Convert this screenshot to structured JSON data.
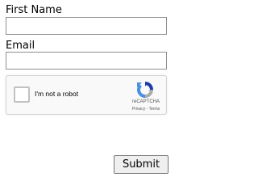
{
  "form": {
    "first_name_label": "First Name",
    "first_name_value": "",
    "email_label": "Email",
    "email_value": "",
    "submit_label": "Submit"
  },
  "recaptcha": {
    "checkbox_label": "I'm not a robot",
    "checked": false,
    "brand": "reCAPTCHA",
    "privacy_link": "Privacy",
    "separator": " - ",
    "terms_link": "Terms",
    "logo_icon": "recaptcha-logo-icon",
    "colors": {
      "blue": "#1c3aa9",
      "light_blue": "#4a90e2",
      "gray": "#ababab"
    }
  }
}
